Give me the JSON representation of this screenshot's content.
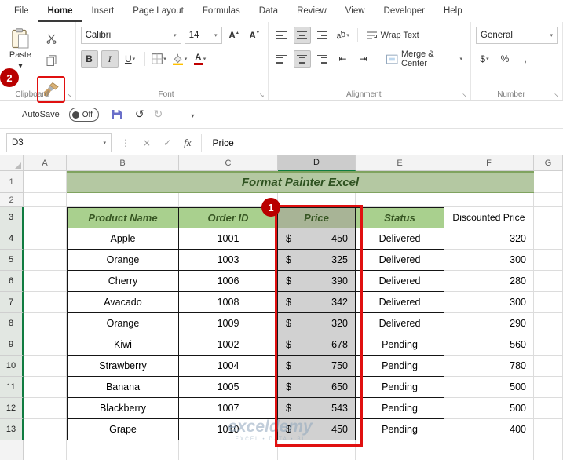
{
  "colors": {
    "accent_green": "#107C41",
    "table_header_fill": "#A9D08E",
    "table_header_text": "#375623",
    "banner_fill": "#B4C8A2",
    "selection_gray": "#D1D1D1",
    "annotation_red": "#C00000"
  },
  "tabs": [
    {
      "label": "File"
    },
    {
      "label": "Home",
      "active": true
    },
    {
      "label": "Insert"
    },
    {
      "label": "Page Layout"
    },
    {
      "label": "Formulas"
    },
    {
      "label": "Data"
    },
    {
      "label": "Review"
    },
    {
      "label": "View"
    },
    {
      "label": "Developer"
    },
    {
      "label": "Help"
    }
  ],
  "ribbon": {
    "clipboard": {
      "paste_label": "Paste",
      "group_label": "Clipboard"
    },
    "font": {
      "name": "Calibri",
      "size": "14",
      "bold": "B",
      "italic": "I",
      "underline": "U",
      "grow": "A",
      "shrink": "A",
      "group_label": "Font"
    },
    "alignment": {
      "orientation": "ab",
      "wrap_text": "Wrap Text",
      "merge_center": "Merge & Center",
      "group_label": "Alignment"
    },
    "number": {
      "format": "General",
      "currency": "$",
      "percent": "%",
      "comma": ",",
      "group_label": "Number"
    }
  },
  "qat": {
    "autosave": "AutoSave",
    "autosave_state": "Off"
  },
  "formula_bar": {
    "name_box": "D3",
    "fx": "fx",
    "value": "Price"
  },
  "icons": {
    "dropdown": "▾",
    "up": "▴",
    "undo": "↺",
    "redo": "↻",
    "launcher": "↘",
    "dots": "⋮",
    "cancel": "×",
    "confirm": "✓",
    "indent_left": "⇤",
    "indent_right": "⇥"
  },
  "grid": {
    "columns": [
      "A",
      "B",
      "C",
      "D",
      "E",
      "F",
      "G"
    ],
    "selected_column": "D",
    "rows": [
      "1",
      "2",
      "3",
      "4",
      "5",
      "6",
      "7",
      "8",
      "9",
      "10",
      "11",
      "12",
      "13"
    ],
    "title": "Format Painter Excel",
    "headers": {
      "product": "Product Name",
      "order": "Order ID",
      "price": "Price",
      "status": "Status",
      "discount": "Discounted Price"
    },
    "data": [
      {
        "product": "Apple",
        "order": "1001",
        "cur": "$",
        "price": "450",
        "status": "Delivered",
        "discount": "320"
      },
      {
        "product": "Orange",
        "order": "1003",
        "cur": "$",
        "price": "325",
        "status": "Delivered",
        "discount": "300"
      },
      {
        "product": "Cherry",
        "order": "1006",
        "cur": "$",
        "price": "390",
        "status": "Delivered",
        "discount": "280"
      },
      {
        "product": "Avacado",
        "order": "1008",
        "cur": "$",
        "price": "342",
        "status": "Delivered",
        "discount": "300"
      },
      {
        "product": "Orange",
        "order": "1009",
        "cur": "$",
        "price": "320",
        "status": "Delivered",
        "discount": "290"
      },
      {
        "product": "Kiwi",
        "order": "1002",
        "cur": "$",
        "price": "678",
        "status": "Pending",
        "discount": "560"
      },
      {
        "product": "Strawberry",
        "order": "1004",
        "cur": "$",
        "price": "750",
        "status": "Pending",
        "discount": "780"
      },
      {
        "product": "Banana",
        "order": "1005",
        "cur": "$",
        "price": "650",
        "status": "Pending",
        "discount": "500"
      },
      {
        "product": "Blackberry",
        "order": "1007",
        "cur": "$",
        "price": "543",
        "status": "Pending",
        "discount": "500"
      },
      {
        "product": "Grape",
        "order": "1010",
        "cur": "$",
        "price": "450",
        "status": "Pending",
        "discount": "400"
      }
    ]
  },
  "annotations": {
    "step1": "1",
    "step2": "2"
  },
  "watermark": {
    "brand": "exceldemy",
    "tagline": "EXCEL • DATA • BI"
  }
}
